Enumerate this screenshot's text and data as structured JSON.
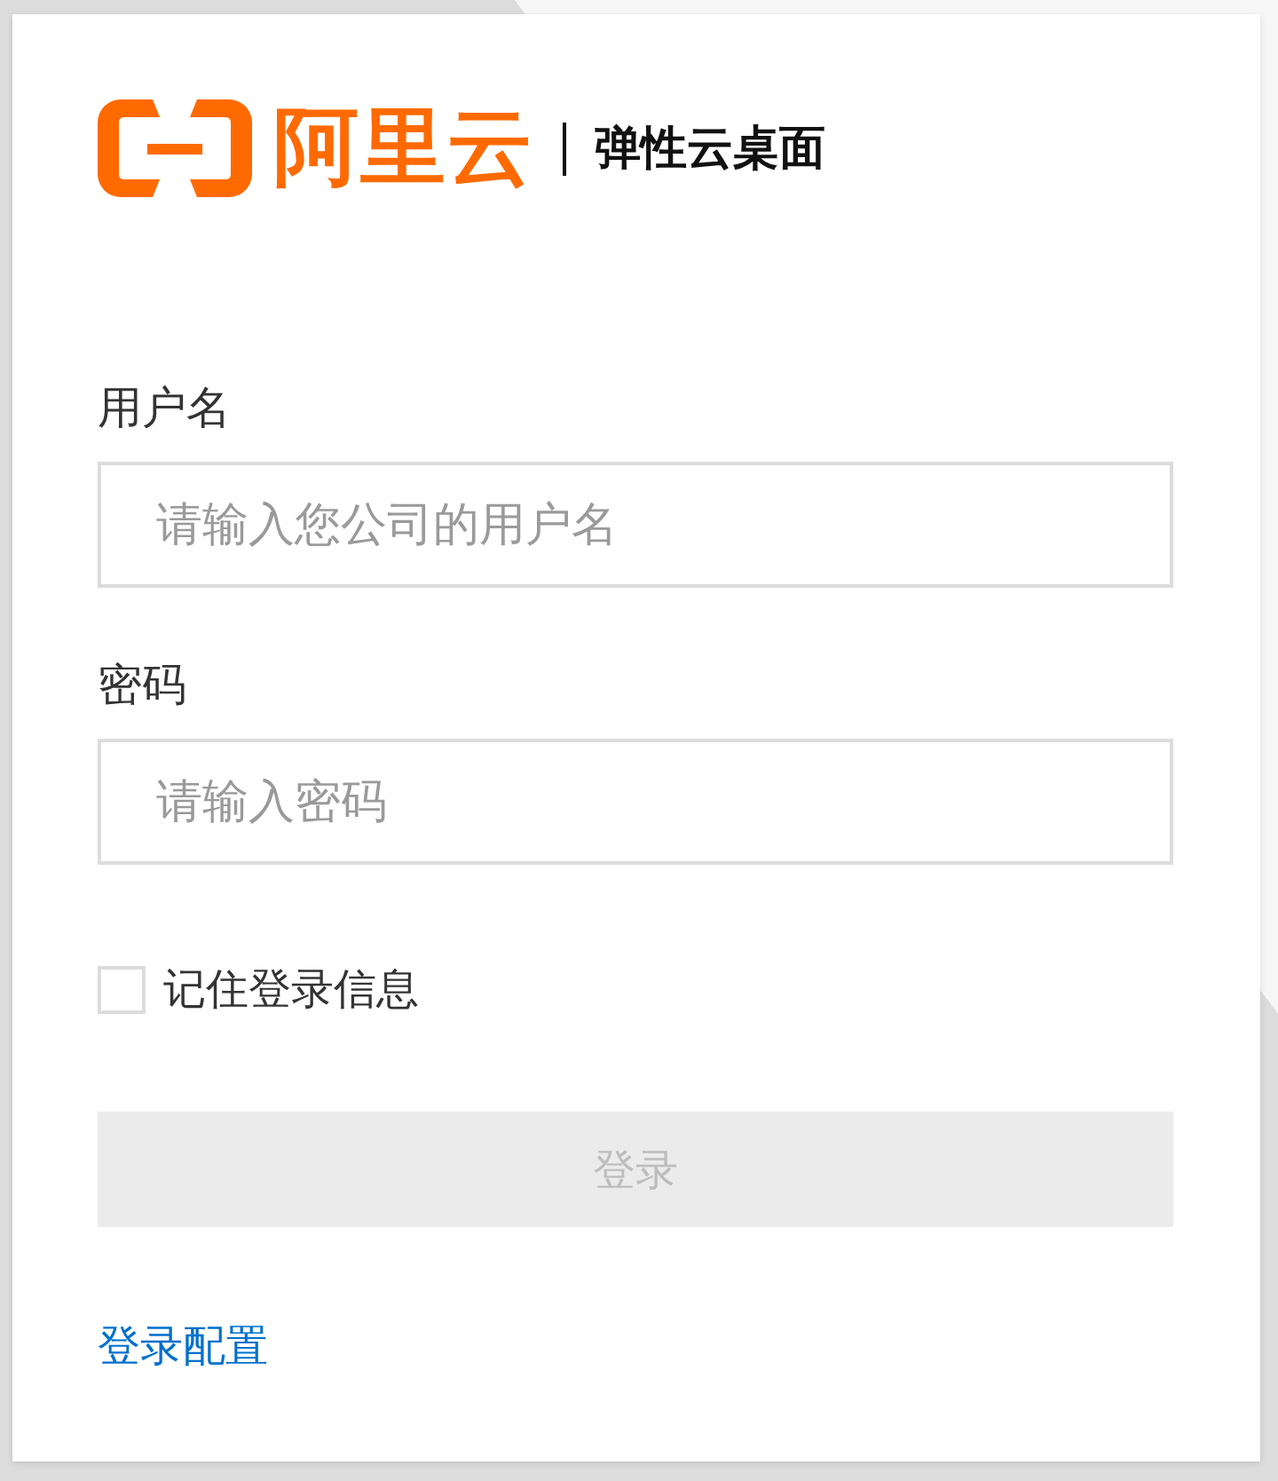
{
  "logo": {
    "brand": "阿里云",
    "product": "弹性云桌面"
  },
  "fields": [
    {
      "label": "用户名",
      "placeholder": "请输入您公司的用户名"
    },
    {
      "label": "密码",
      "placeholder": "请输入密码"
    }
  ],
  "remember": {
    "label": "记住登录信息",
    "checked": false
  },
  "login_button": {
    "label": "登录",
    "disabled": true
  },
  "config_link": {
    "label": "登录配置"
  }
}
